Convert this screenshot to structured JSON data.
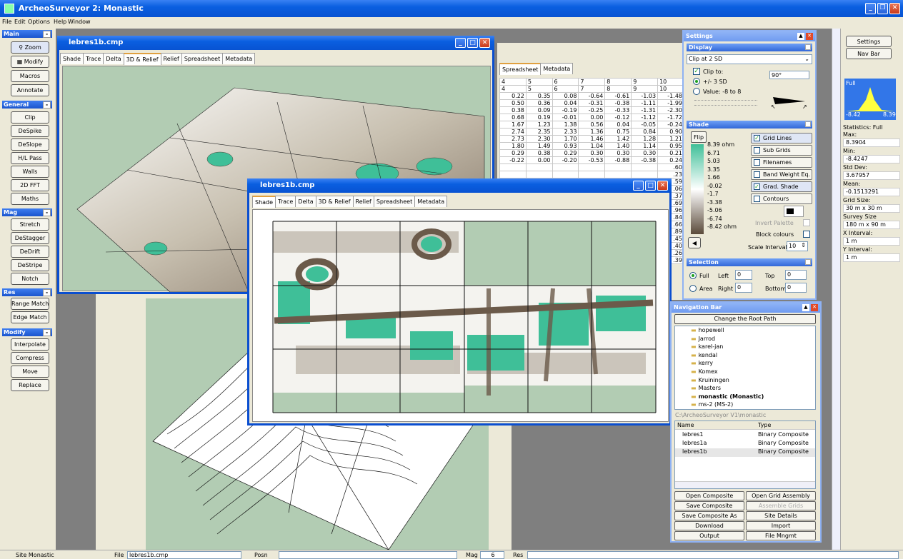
{
  "app_title": "ArcheoSurveyor 2: Monastic",
  "menu": [
    "File",
    "Edit",
    "Options",
    "Help",
    "Window"
  ],
  "left_panel": {
    "main": {
      "title": "Main",
      "buttons": [
        "Zoom",
        "Modify",
        "Macros",
        "Annotate"
      ]
    },
    "general": {
      "title": "General",
      "buttons": [
        "Clip",
        "DeSpike",
        "DeSlope",
        "H/L Pass",
        "Walls",
        "2D FFT",
        "Maths"
      ]
    },
    "mag": {
      "title": "Mag",
      "buttons": [
        "Stretch",
        "DeStagger",
        "DeDrift",
        "DeStripe",
        "Notch"
      ]
    },
    "res": {
      "title": "Res",
      "buttons": [
        "Range Match",
        "Edge Match"
      ]
    },
    "modify": {
      "title": "Modify",
      "buttons": [
        "Interpolate",
        "Compress",
        "Move",
        "Replace"
      ]
    }
  },
  "window_back": {
    "title": "lebres1b.cmp",
    "tabs": [
      "Shade",
      "Trace",
      "Delta",
      "3D & Relief",
      "Relief",
      "Spreadsheet",
      "Metadata"
    ],
    "active_tab": "3D & Relief"
  },
  "window_front": {
    "title": "lebres1b.cmp",
    "tabs": [
      "Shade",
      "Trace",
      "Delta",
      "3D & Relief",
      "Relief",
      "Spreadsheet",
      "Metadata"
    ],
    "active_tab": "Shade"
  },
  "spreadsheet": {
    "tabs": [
      "Spreadsheet",
      "Metadata"
    ],
    "header1": [
      "4",
      "5",
      "6",
      "7",
      "8",
      "9",
      "10"
    ],
    "header2": [
      "4",
      "5",
      "6",
      "7",
      "8",
      "9",
      "10"
    ],
    "rows": [
      [
        "0.22",
        "0.35",
        "0.08",
        "-0.64",
        "-0.61",
        "-1.03",
        "-1.48"
      ],
      [
        "0.50",
        "0.36",
        "0.04",
        "-0.31",
        "-0.38",
        "-1.11",
        "-1.99"
      ],
      [
        "0.38",
        "0.09",
        "-0.19",
        "-0.25",
        "-0.33",
        "-1.31",
        "-2.30"
      ],
      [
        "0.68",
        "0.19",
        "-0.01",
        "0.00",
        "-0.12",
        "-1.12",
        "-1.72"
      ],
      [
        "1.67",
        "1.23",
        "1.38",
        "0.56",
        "0.04",
        "-0.05",
        "-0.24"
      ],
      [
        "2.74",
        "2.35",
        "2.33",
        "1.36",
        "0.75",
        "0.84",
        "0.90"
      ],
      [
        "2.73",
        "2.30",
        "1.70",
        "1.46",
        "1.42",
        "1.28",
        "1.21"
      ],
      [
        "1.80",
        "1.49",
        "0.93",
        "1.04",
        "1.40",
        "1.14",
        "0.95"
      ],
      [
        "0.29",
        "0.38",
        "0.29",
        "0.30",
        "0.30",
        "0.30",
        "0.21"
      ],
      [
        "-0.22",
        "0.00",
        "-0.20",
        "-0.53",
        "-0.88",
        "-0.38",
        "0.24"
      ]
    ],
    "right_col": [
      ".60",
      ".23",
      ".59",
      ".06",
      ".37",
      ".69",
      ".96",
      ".84",
      ".66",
      ".89",
      ".45",
      ".40",
      ".26",
      ".39"
    ]
  },
  "settings": {
    "title": "Settings",
    "display": {
      "title": "Display",
      "clip_select": "Clip at 2 SD",
      "clip_to": "Clip to:",
      "opt1": "+/- 3 SD",
      "opt2": "Value: -8 to 8",
      "angle": "90°"
    },
    "shade": {
      "title": "Shade",
      "flip": "Flip",
      "scale": [
        "8.39 ohm",
        "6.71",
        "5.03",
        "3.35",
        "1.66",
        "-0.02",
        "-1.7",
        "-3.38",
        "-5.06",
        "-6.74",
        "-8.42 ohm"
      ],
      "checks": [
        "Grid Lines",
        "Sub Grids",
        "Filenames",
        "Band Weight Eq.",
        "Grad. Shade",
        "Contours"
      ],
      "checks_on": [
        true,
        false,
        false,
        false,
        true,
        false
      ],
      "invert_palette": "Invert Palette",
      "block_colours": "Block colours",
      "scale_intervals": "Scale Intervals",
      "scale_intervals_value": "10"
    },
    "selection": {
      "title": "Selection",
      "full": "Full",
      "area": "Area",
      "left": "Left",
      "right": "Right",
      "top": "Top",
      "bottom": "Bottom",
      "left_val": "0",
      "right_val": "0",
      "top_val": "0",
      "bottom_val": "0"
    }
  },
  "nav_bar": {
    "title": "Navigation Bar",
    "change_root": "Change the Root Path",
    "folders": [
      "hopewell",
      "Jarrod",
      "karel-jan",
      "kendal",
      "kerry",
      "Komex",
      "Kruiningen",
      "Masters",
      "monastic (Monastic)",
      "ms-2 (MS-2)"
    ],
    "path": "C:\\ArcheoSurveyor V1\\monastic",
    "col_name": "Name",
    "col_type": "Type",
    "files": [
      {
        "name": "lebres1",
        "type": "Binary Composite"
      },
      {
        "name": "lebres1a",
        "type": "Binary Composite"
      },
      {
        "name": "lebres1b",
        "type": "Binary Composite"
      }
    ],
    "buttons": [
      "Open Composite",
      "Open Grid Assembly",
      "Save Composite",
      "Assemble Grids",
      "Save Composite As",
      "Site Details",
      "Download",
      "Import",
      "Output",
      "File Mngmt"
    ]
  },
  "right_panel": {
    "settings_btn": "Settings",
    "navbar_btn": "Nav Bar",
    "hist_label": "Full",
    "hist_min": "-8.42",
    "hist_max": "8.39",
    "stats": [
      {
        "label": "Statistics: Full",
        "value": ""
      },
      {
        "label": "Max:",
        "value": "8.3904"
      },
      {
        "label": "Min:",
        "value": "-8.4247"
      },
      {
        "label": "Std Dev:",
        "value": "3.67957"
      },
      {
        "label": "Mean:",
        "value": "-0.1513291"
      },
      {
        "label": "Grid Size:",
        "value": "30 m x 30 m"
      },
      {
        "label": "Survey Size",
        "value": "180 m x 90 m"
      },
      {
        "label": "X Interval:",
        "value": "1 m"
      },
      {
        "label": "Y Interval:",
        "value": "1 m"
      }
    ]
  },
  "status_bar": {
    "site": "Site Monastic",
    "file_label": "File",
    "file_value": "lebres1b.cmp",
    "posn": "Posn",
    "mag": "Mag",
    "mag_value": "6",
    "res": "Res"
  },
  "colors": {
    "accent": "#0a5fe0",
    "shade_teal": "#3fbf98",
    "shade_brown": "#6b5a4a",
    "bg_green": "#b2ccb3"
  }
}
